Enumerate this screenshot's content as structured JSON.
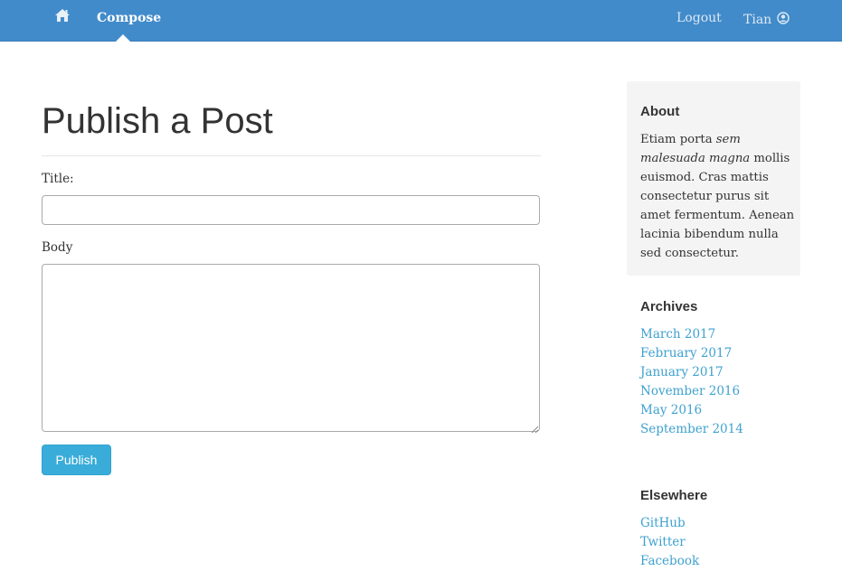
{
  "navbar": {
    "home_icon": "home-icon",
    "compose_label": "Compose",
    "logout_label": "Logout",
    "user_name": "Tian",
    "user_icon": "user-circle-icon",
    "background_color": "#428bca"
  },
  "main": {
    "page_title": "Publish a Post",
    "title_label": "Title:",
    "title_value": "",
    "body_label": "Body",
    "body_value": "",
    "publish_label": "Publish",
    "publish_color": "#39acd9"
  },
  "sidebar": {
    "about": {
      "heading": "About",
      "text_before": "Etiam porta ",
      "text_em": "sem malesuada magna",
      "text_after": " mollis euismod. Cras mattis consectetur purus sit amet fermentum. Aenean lacinia bibendum nulla sed consectetur."
    },
    "archives": {
      "heading": "Archives",
      "links": [
        "March 2017",
        "February 2017",
        "January 2017",
        "November 2016",
        "May 2016",
        "September 2014"
      ]
    },
    "elsewhere": {
      "heading": "Elsewhere",
      "links": [
        "GitHub",
        "Twitter",
        "Facebook"
      ]
    },
    "link_color": "#3ea1cf"
  }
}
